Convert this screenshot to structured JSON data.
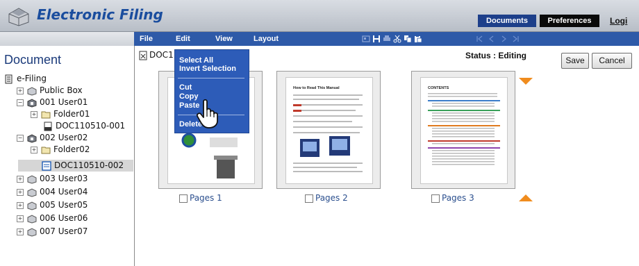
{
  "header": {
    "title": "Electronic Filing",
    "tabs": [
      {
        "label": "Documents",
        "active": true
      },
      {
        "label": "Preferences",
        "active": false
      }
    ],
    "login": "Logi"
  },
  "menubar": {
    "items": [
      "File",
      "Edit",
      "View",
      "Layout"
    ]
  },
  "edit_menu": {
    "items": [
      "Select All",
      "Invert Selection",
      "Cut",
      "Copy",
      "Paste",
      "Delete"
    ]
  },
  "left": {
    "title": "Document",
    "tree": [
      {
        "label": "e-Filing",
        "icon": "efiling-icon"
      },
      {
        "label": "Public Box",
        "icon": "public-box-icon"
      },
      {
        "label": "001 User01",
        "icon": "user-box-icon"
      },
      {
        "label": "Folder01",
        "icon": "folder-icon"
      },
      {
        "label": "DOC110510-001",
        "icon": "document-icon"
      },
      {
        "label": "002 User02",
        "icon": "user-box-icon"
      },
      {
        "label": "Folder02",
        "icon": "folder-icon"
      },
      {
        "label": "DOC110510-002",
        "icon": "document-open-icon",
        "selected": true
      },
      {
        "label": "003 User03",
        "icon": "user-box-icon"
      },
      {
        "label": "004 User04",
        "icon": "user-box-icon"
      },
      {
        "label": "005 User05",
        "icon": "user-box-icon"
      },
      {
        "label": "006 User06",
        "icon": "user-box-icon"
      },
      {
        "label": "007 User07",
        "icon": "user-box-icon"
      }
    ]
  },
  "main": {
    "doc_name": "DOC1",
    "status": "Status : Editing",
    "save_label": "Save",
    "cancel_label": "Cancel",
    "pages": [
      {
        "label": "Pages 1"
      },
      {
        "label": "Pages 2"
      },
      {
        "label": "Pages 3"
      }
    ],
    "page2_heading": "How to Read This Manual",
    "page3_heading": "CONTENTS"
  },
  "colors": {
    "accent": "#2e5aa8",
    "title": "#1a4d9e",
    "arrow": "#f08c1e"
  }
}
